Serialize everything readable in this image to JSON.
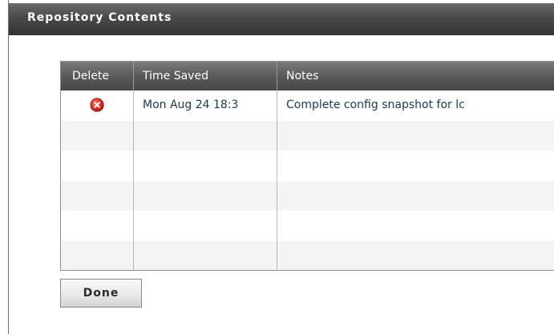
{
  "dialog": {
    "title": "Repository Contents",
    "done_label": "Done"
  },
  "table": {
    "columns": [
      "Delete",
      "Time Saved",
      "Notes"
    ],
    "rows": [
      {
        "delete_icon": "delete-circle-icon",
        "time_saved": "Mon Aug 24 18:3",
        "notes": "Complete config snapshot for lc"
      }
    ],
    "empty_rows": 5
  },
  "colors": {
    "header_bg": "#4a4a4a",
    "cell_text": "#1c3a4a",
    "delete_icon": "#d9302c",
    "alt_row": "#f4f4f4"
  }
}
